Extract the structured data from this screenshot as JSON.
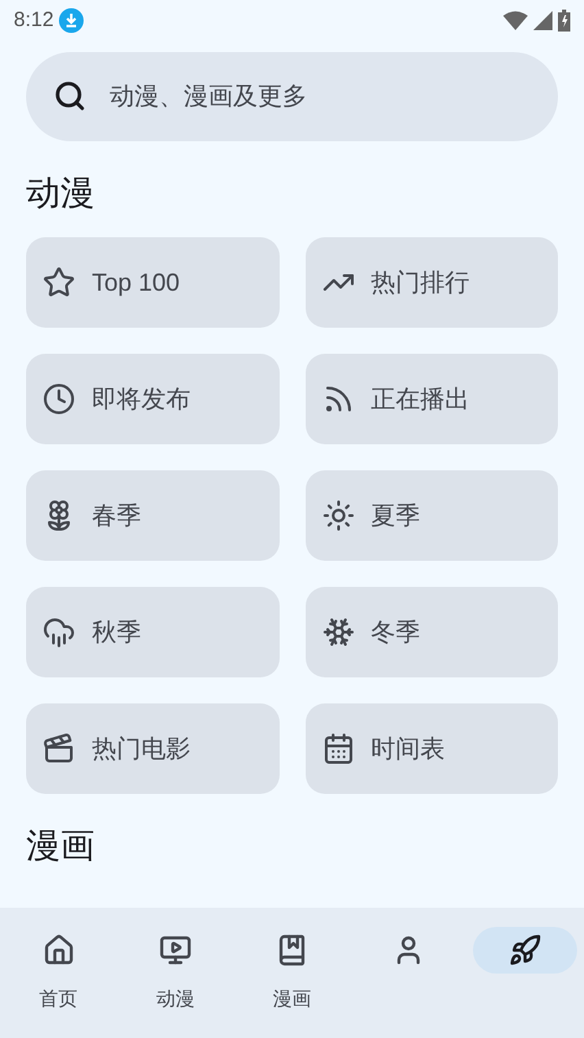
{
  "status_bar": {
    "time": "8:12"
  },
  "search": {
    "placeholder": "动漫、漫画及更多"
  },
  "sections": [
    {
      "title": "动漫",
      "tiles": [
        {
          "label": "Top 100"
        },
        {
          "label": "热门排行"
        },
        {
          "label": "即将发布"
        },
        {
          "label": "正在播出"
        },
        {
          "label": "春季"
        },
        {
          "label": "夏季"
        },
        {
          "label": "秋季"
        },
        {
          "label": "冬季"
        },
        {
          "label": "热门电影"
        },
        {
          "label": "时间表"
        }
      ]
    },
    {
      "title": "漫画"
    }
  ],
  "nav": [
    {
      "label": "首页",
      "selected": false
    },
    {
      "label": "动漫",
      "selected": false
    },
    {
      "label": "漫画",
      "selected": false
    },
    {
      "selected": false
    },
    {
      "selected": true
    }
  ]
}
